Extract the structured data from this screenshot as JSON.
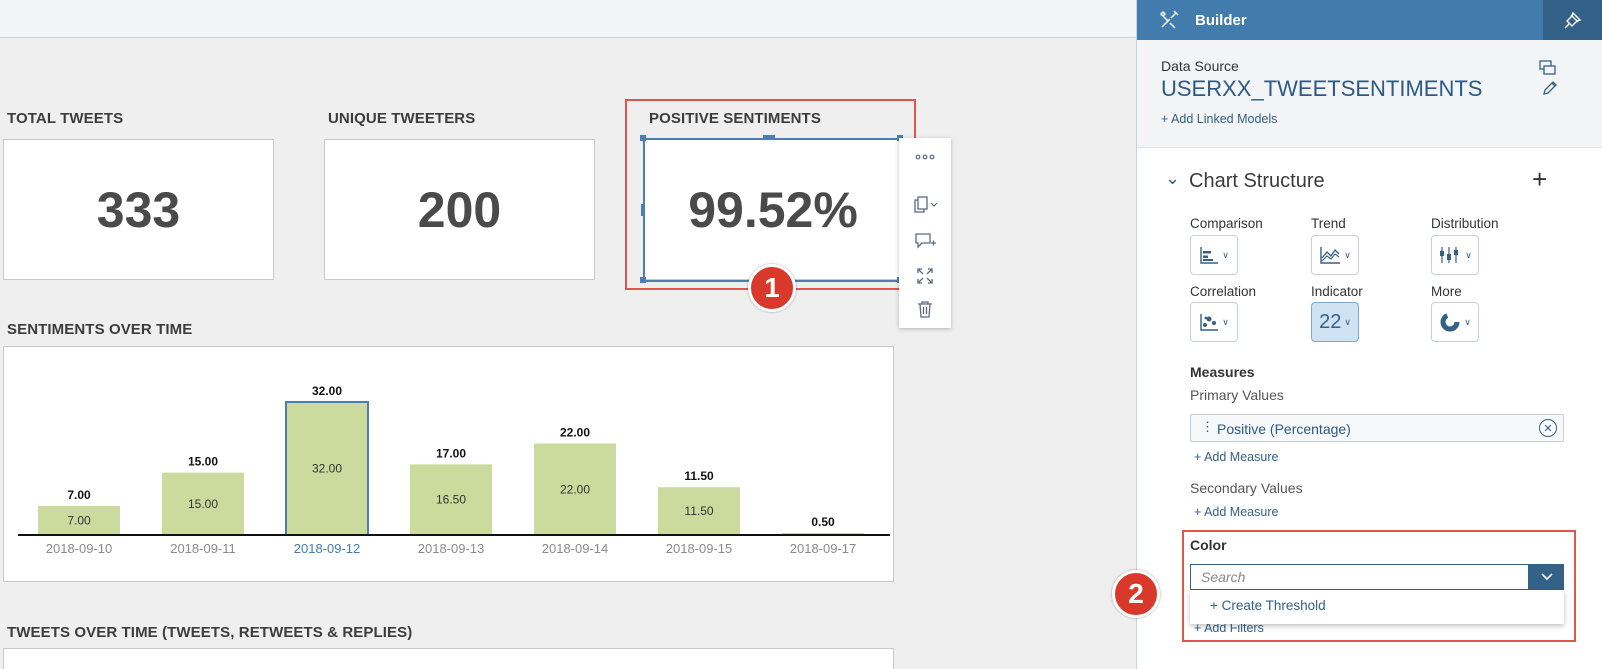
{
  "kpis": [
    {
      "title": "TOTAL TWEETS",
      "value": "333"
    },
    {
      "title": "UNIQUE TWEETERS",
      "value": "200"
    },
    {
      "title": "POSITIVE SENTIMENTS",
      "value": "99.52%"
    }
  ],
  "callouts": {
    "one": "1",
    "two": "2"
  },
  "sections": {
    "sentiments_title": "SENTIMENTS OVER TIME",
    "tweets_title": "TWEETS OVER TIME (TWEETS, RETWEETS & REPLIES)"
  },
  "chart_data": {
    "type": "bar",
    "categories": [
      "2018-09-10",
      "2018-09-11",
      "2018-09-12",
      "2018-09-13",
      "2018-09-14",
      "2018-09-15",
      "2018-09-17"
    ],
    "values": [
      7.0,
      15.0,
      32.0,
      17.0,
      22.0,
      11.5,
      0.5
    ],
    "inner_labels": [
      "7.00",
      "15.00",
      "32.00",
      "16.50",
      "22.00",
      "11.50",
      ""
    ],
    "top_labels": [
      "7.00",
      "15.00",
      "32.00",
      "17.00",
      "22.00",
      "11.50",
      "0.50"
    ],
    "selected_category": "2018-09-12",
    "bar_color": "#cbda9d",
    "selected_border_color": "#4d7db1",
    "ylim": [
      0,
      32
    ]
  },
  "panel": {
    "title": "Builder",
    "data_source_label": "Data Source",
    "data_source_name": "USERXX_TWEETSENTIMENTS",
    "add_linked_models": "+ Add Linked Models",
    "chart_structure": "Chart Structure",
    "types": [
      {
        "label": "Comparison",
        "icon": "bar-chart-icon"
      },
      {
        "label": "Trend",
        "icon": "area-chart-icon"
      },
      {
        "label": "Distribution",
        "icon": "box-plot-icon"
      },
      {
        "label": "Correlation",
        "icon": "scatter-icon"
      },
      {
        "label": "Indicator",
        "icon": "numeric-icon",
        "glyph": "22"
      },
      {
        "label": "More",
        "icon": "donut-icon"
      }
    ],
    "measures_label": "Measures",
    "primary_values_label": "Primary Values",
    "primary_measure": "Positive (Percentage)",
    "add_measure": "+ Add Measure",
    "secondary_values_label": "Secondary Values",
    "color_label": "Color",
    "search_placeholder": "Search",
    "create_threshold": "+ Create Threshold",
    "add_filters": "+ Add Filters"
  },
  "colors": {
    "accent": "#346187",
    "header": "#427cac",
    "callout": "#d9392b"
  }
}
